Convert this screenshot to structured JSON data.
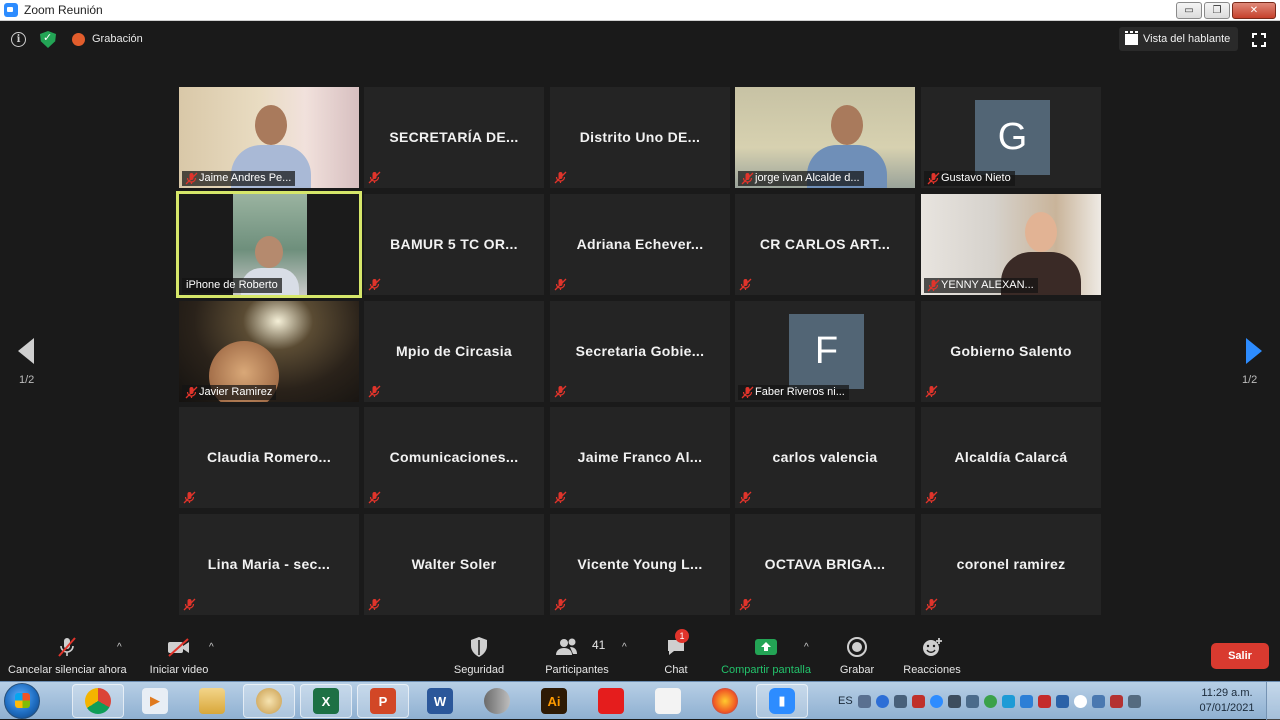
{
  "window": {
    "title": "Zoom Reunión",
    "minimize": "▭",
    "maximize": "❐",
    "close": "✕"
  },
  "topbar": {
    "recording_label": "Grabación",
    "view_button": "Vista del hablante"
  },
  "navigation": {
    "page_indicator_left": "1/2",
    "page_indicator_right": "1/2"
  },
  "tiles": [
    {
      "name": "Jaime Andres Pe...",
      "type": "video",
      "muted": true
    },
    {
      "name": "SECRETARÍA DE...",
      "type": "name",
      "muted": true
    },
    {
      "name": "Distrito Uno DE...",
      "type": "name",
      "muted": true
    },
    {
      "name": "jorge ivan Alcalde d...",
      "type": "video",
      "muted": true
    },
    {
      "name": "Gustavo Nieto",
      "type": "avatar",
      "initial": "G",
      "muted": true
    },
    {
      "name": "iPhone de Roberto",
      "type": "video",
      "muted": false,
      "active": true
    },
    {
      "name": "BAMUR 5 TC OR...",
      "type": "name",
      "muted": true
    },
    {
      "name": "Adriana Echever...",
      "type": "name",
      "muted": true
    },
    {
      "name": "CR CARLOS ART...",
      "type": "name",
      "muted": true
    },
    {
      "name": "YENNY ALEXAN...",
      "type": "video",
      "muted": true
    },
    {
      "name": "Javier Ramirez",
      "type": "video",
      "muted": true
    },
    {
      "name": "Mpio de Circasia",
      "type": "name",
      "muted": true
    },
    {
      "name": "Secretaria Gobie...",
      "type": "name",
      "muted": true
    },
    {
      "name": "Faber Riveros ni...",
      "type": "avatar",
      "initial": "F",
      "muted": true
    },
    {
      "name": "Gobierno Salento",
      "type": "name",
      "muted": true
    },
    {
      "name": "Claudia Romero...",
      "type": "name",
      "muted": true
    },
    {
      "name": "Comunicaciones...",
      "type": "name",
      "muted": true
    },
    {
      "name": "Jaime Franco Al...",
      "type": "name",
      "muted": true
    },
    {
      "name": "carlos valencia",
      "type": "name",
      "muted": true
    },
    {
      "name": "Alcaldía Calarcá",
      "type": "name",
      "muted": true
    },
    {
      "name": "Lina Maria - sec...",
      "type": "name",
      "muted": true
    },
    {
      "name": "Walter Soler",
      "type": "name",
      "muted": true
    },
    {
      "name": "Vicente Young L...",
      "type": "name",
      "muted": true
    },
    {
      "name": "OCTAVA BRIGA...",
      "type": "name",
      "muted": true
    },
    {
      "name": "coronel ramirez",
      "type": "name",
      "muted": true
    }
  ],
  "toolbar": {
    "unmute": "Cancelar silenciar ahora",
    "start_video": "Iniciar video",
    "security": "Seguridad",
    "participants": "Participantes",
    "participants_count": "41",
    "chat": "Chat",
    "chat_badge": "1",
    "share_screen": "Compartir pantalla",
    "record": "Grabar",
    "reactions": "Reacciones",
    "leave": "Salir",
    "caret": "^"
  },
  "taskbar": {
    "apps": [
      "chrome-icon",
      "media-player-icon",
      "file-explorer-icon",
      "paint-icon",
      "excel-icon",
      "powerpoint-icon",
      "word-icon",
      "microphone-icon",
      "illustrator-icon",
      "acrobat-icon",
      "snipping-tool-icon",
      "firefox-icon",
      "zoom-icon"
    ],
    "language": "ES",
    "time": "11:29 a.m.",
    "date": "07/01/2021"
  },
  "colors": {
    "accent_blue": "#2d8cff",
    "share_green": "#23a455",
    "leave_red": "#d93a2f",
    "active_outline": "#d6e76a",
    "tile_bg": "#242424",
    "avatar_bg": "#526575"
  }
}
